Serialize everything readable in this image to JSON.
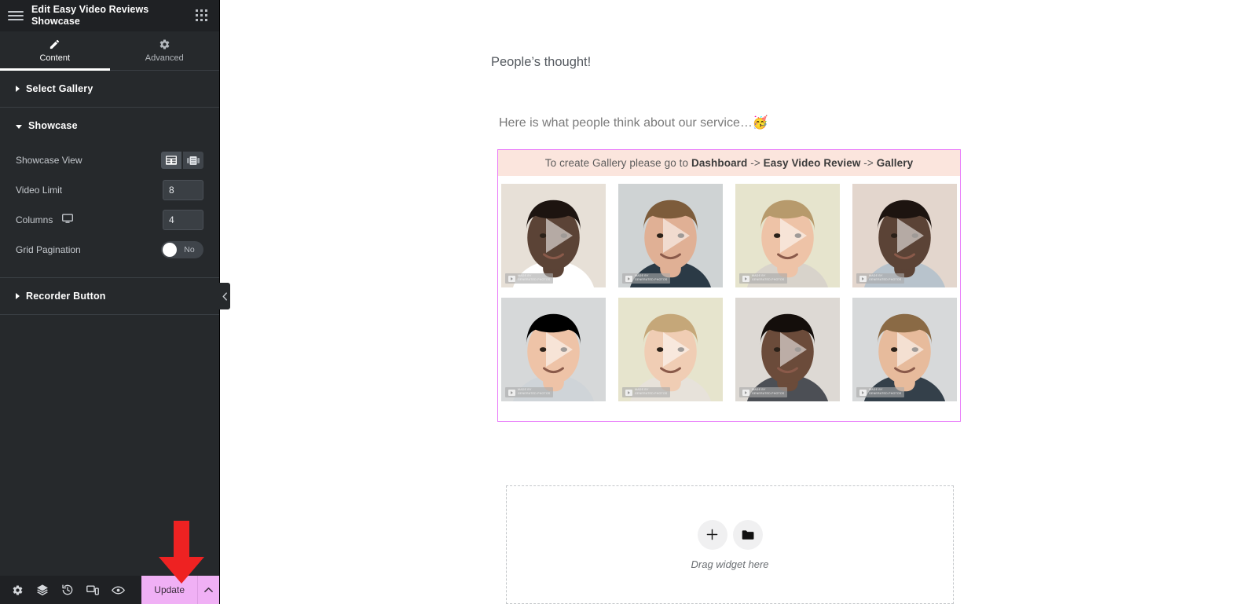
{
  "panel": {
    "title": "Edit Easy Video Reviews Showcase",
    "menu_icon": "hamburger-icon",
    "apps_icon": "apps-grid-icon",
    "tabs": [
      {
        "label": "Content",
        "icon": "pencil-icon",
        "active": true
      },
      {
        "label": "Advanced",
        "icon": "gear-icon",
        "active": false
      }
    ],
    "sections": [
      {
        "label": "Select Gallery",
        "expanded": false
      },
      {
        "label": "Showcase",
        "expanded": true
      },
      {
        "label": "Recorder Button",
        "expanded": false
      }
    ],
    "showcase": {
      "view_label": "Showcase View",
      "view_options": [
        {
          "icon": "grid-view-icon",
          "selected": true
        },
        {
          "icon": "carousel-view-icon",
          "selected": false
        }
      ],
      "video_limit_label": "Video Limit",
      "video_limit_value": "8",
      "columns_label": "Columns",
      "columns_device_icon": "desktop-icon",
      "columns_value": "4",
      "grid_pagination_label": "Grid Pagination",
      "grid_pagination_value": "No",
      "grid_pagination_on": false
    },
    "footer": {
      "icons": [
        "settings-gear-icon",
        "navigator-layers-icon",
        "history-icon",
        "responsive-mode-icon",
        "preview-eye-icon"
      ],
      "update_label": "Update",
      "update_caret_icon": "chevron-up-icon",
      "update_color": "#f0b0f5"
    },
    "collapse_handle_icon": "chevron-left-icon",
    "annotation": {
      "type": "red-arrow-down",
      "color": "#ee2222"
    }
  },
  "canvas": {
    "heading": "People’s thought!",
    "subtext": "Here is what people think about our service…🥳",
    "widget": {
      "notice": {
        "prefix": "To create Gallery please go to ",
        "link1": "Dashboard",
        "sep1": " -> ",
        "link2": "Easy Video Review",
        "sep2": " -> ",
        "link3": "Gallery"
      },
      "border_color": "#e879f9",
      "notice_bg": "#fbe5dd",
      "thumbnails": [
        {
          "badge_line1": "MADE BY",
          "badge_line2": "GENERATED.PHOTOS",
          "play_icon": "play-triangle-icon",
          "bg": "#e7e0d7",
          "skin": "#5b4336",
          "hair": "#1d1410",
          "shirt": "#ffffff"
        },
        {
          "badge_line1": "MADE BY",
          "badge_line2": "GENERATED.PHOTOS",
          "play_icon": "play-triangle-icon",
          "bg": "#cfd3d4",
          "skin": "#e0b095",
          "hair": "#7d5c3b",
          "shirt": "#2b3a46"
        },
        {
          "badge_line1": "MADE BY",
          "badge_line2": "GENERATED.PHOTOS",
          "play_icon": "play-triangle-icon",
          "bg": "#e6e4cd",
          "skin": "#eec3a7",
          "hair": "#b79a6c",
          "shirt": "#d8d3cb"
        },
        {
          "badge_line1": "MADE BY",
          "badge_line2": "GENERATED.PHOTOS",
          "play_icon": "play-triangle-icon",
          "bg": "#e3d6cd",
          "skin": "#5b4336",
          "hair": "#1d1410",
          "shirt": "#b8c3cc"
        },
        {
          "badge_line1": "MADE BY",
          "badge_line2": "GENERATED.PHOTOS",
          "play_icon": "play-triangle-icon",
          "bg": "#d6d8d9",
          "skin": "#eec3a7",
          "hair": "#9a7murr",
          "shirt": "#cfd4d8"
        },
        {
          "badge_line1": "MADE BY",
          "badge_line2": "GENERATED.PHOTOS",
          "play_icon": "play-triangle-icon",
          "bg": "#e6e4cd",
          "skin": "#f0cdb4",
          "hair": "#c5a779",
          "shirt": "#e7e2da"
        },
        {
          "badge_line1": "MADE BY",
          "badge_line2": "GENERATED.PHOTOS",
          "play_icon": "play-triangle-icon",
          "bg": "#ddd9d4",
          "skin": "#6b4b3a",
          "hair": "#140e0b",
          "shirt": "#4c4f55"
        },
        {
          "badge_line1": "MADE BY",
          "badge_line2": "GENERATED.PHOTOS",
          "play_icon": "play-triangle-icon",
          "bg": "#d7d9da",
          "skin": "#e7bb9c",
          "hair": "#8a6a45",
          "shirt": "#34404a"
        }
      ]
    },
    "dropzone": {
      "add_icon": "plus-icon",
      "folder_icon": "folder-icon",
      "label": "Drag widget here"
    }
  }
}
